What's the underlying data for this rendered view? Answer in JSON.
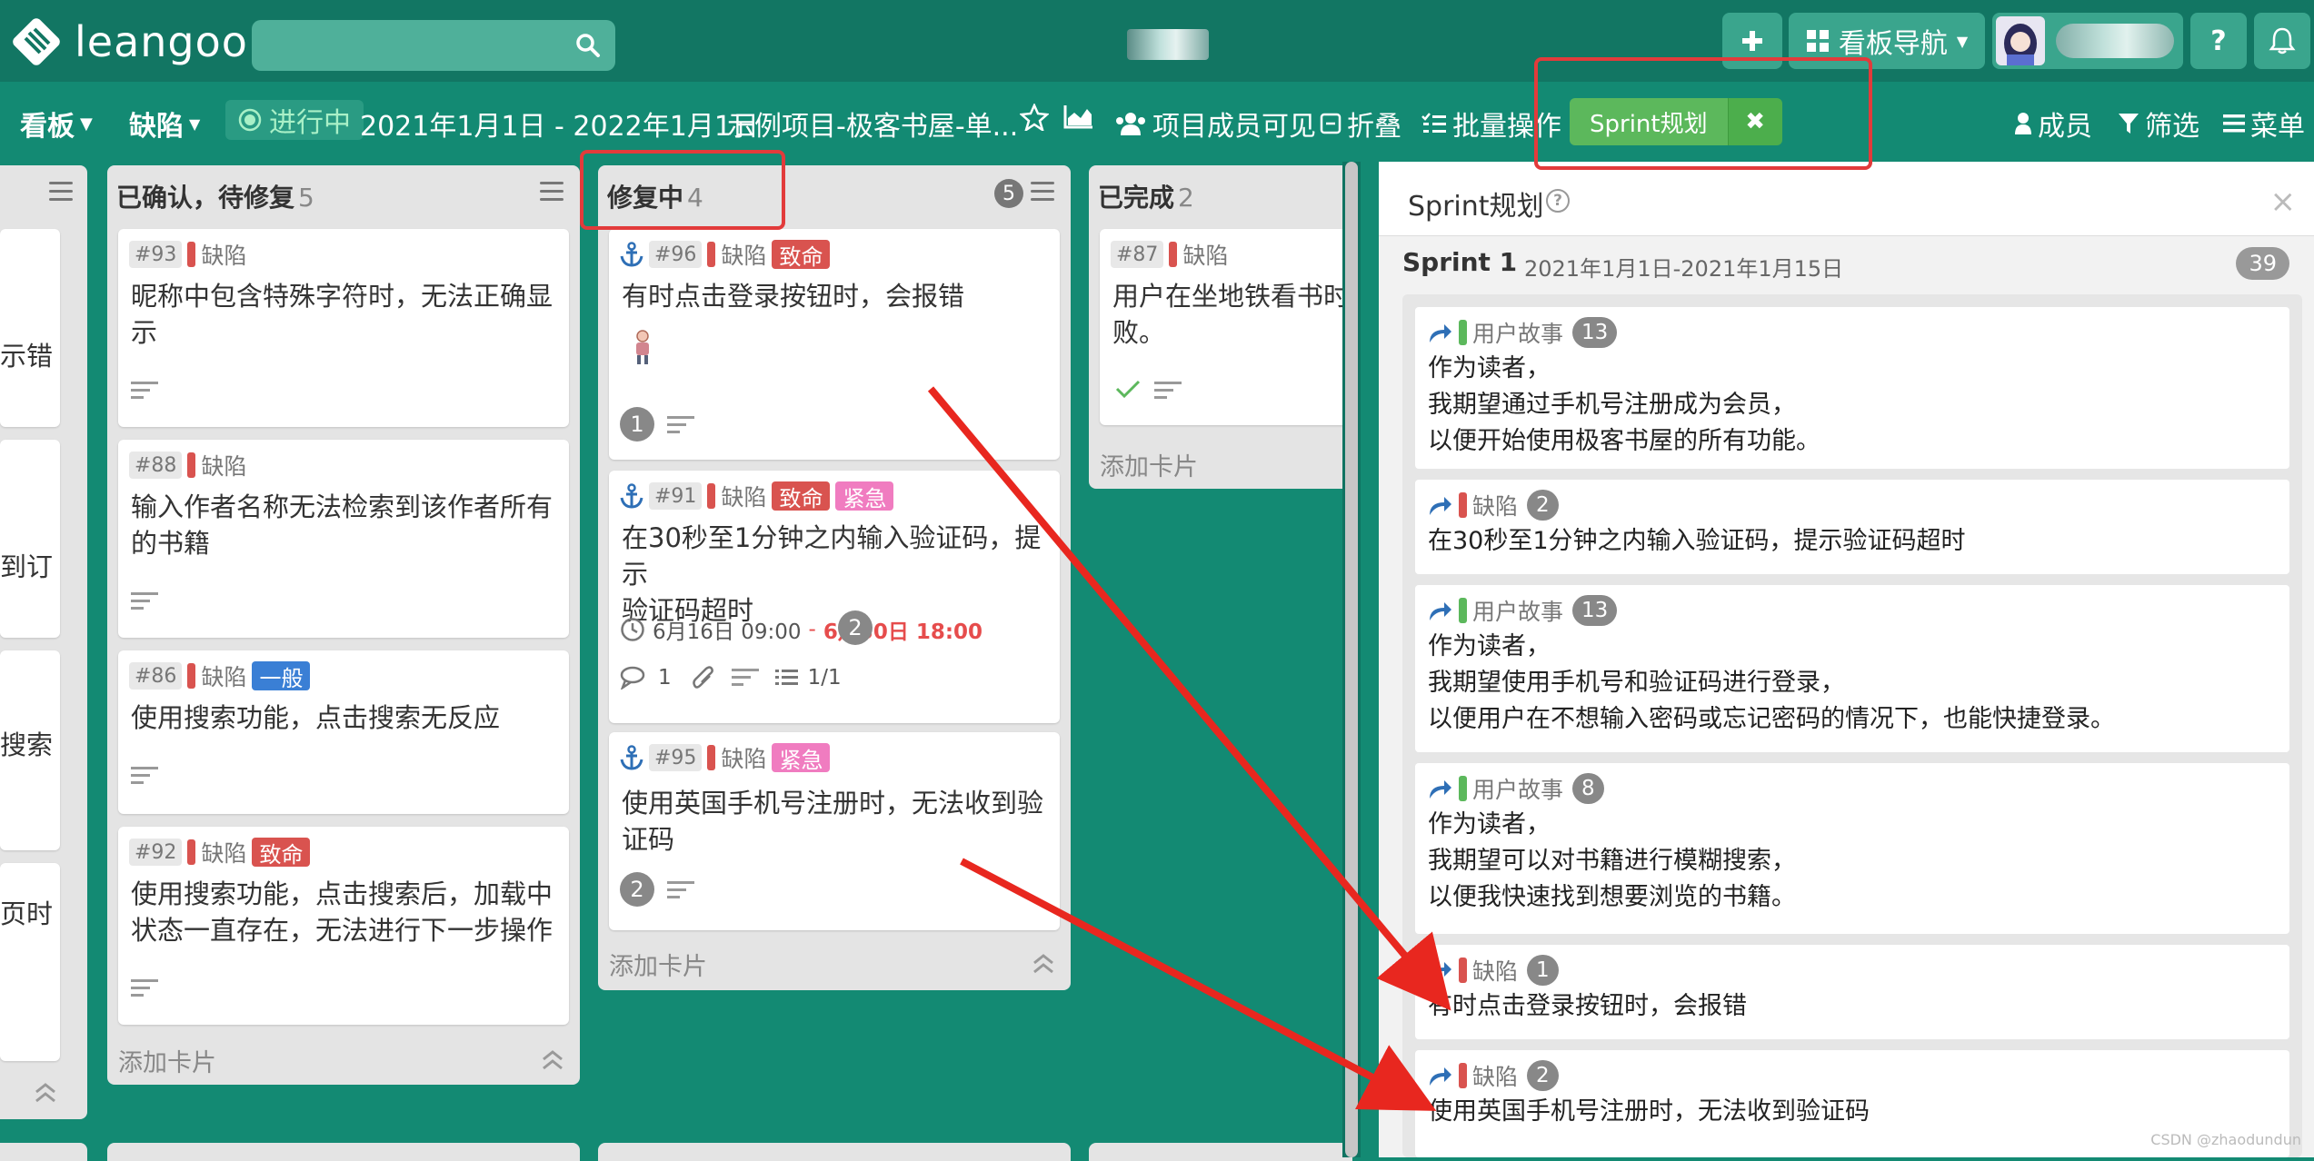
{
  "app": {
    "logo_text": "leangoo"
  },
  "topbar": {
    "search_placeholder": "",
    "board_nav_label": "看板导航",
    "help_label": "?"
  },
  "boardbar": {
    "kanban_label": "看板",
    "board_name": "缺陷",
    "status": "进行中",
    "date_range": "2021年1月1日 - 2022年1月1日",
    "project": "示例项目-极客书屋-单...",
    "visibility": "项目成员可见",
    "fold": "折叠",
    "batch": "批量操作",
    "sprint_button": "Sprint规划",
    "sprint_close": "✖",
    "members": "成员",
    "filter": "筛选",
    "menu": "菜单"
  },
  "lists": {
    "left_partial": {
      "cards": [
        "示错",
        "到订",
        "搜索",
        "页时"
      ]
    },
    "confirmed": {
      "title": "已确认，待修复",
      "count": "5",
      "add_card": "添加卡片",
      "cards": [
        {
          "id": "#93",
          "type": "缺陷",
          "tags": [],
          "title_lines": [
            "昵称中包含特殊字符时，无法正确显",
            "示"
          ]
        },
        {
          "id": "#88",
          "type": "缺陷",
          "tags": [],
          "title_lines": [
            "输入作者名称无法检索到该作者所有",
            "的书籍"
          ]
        },
        {
          "id": "#86",
          "type": "缺陷",
          "tags": [
            {
              "label": "一般",
              "color": "#3a7fd5"
            }
          ],
          "title_lines": [
            "使用搜索功能，点击搜索无反应"
          ]
        },
        {
          "id": "#92",
          "type": "缺陷",
          "tags": [
            {
              "label": "致命",
              "color": "#d9534f"
            }
          ],
          "title_lines": [
            "使用搜索功能，点击搜索后，加载中",
            "状态一直存在，无法进行下一步操作"
          ]
        }
      ]
    },
    "fixing": {
      "title": "修复中",
      "count": "4",
      "wip_limit": "5",
      "add_card": "添加卡片",
      "cards": [
        {
          "id": "#96",
          "type": "缺陷",
          "tags": [
            {
              "label": "致命",
              "color": "#d9534f"
            }
          ],
          "title_lines": [
            "有时点击登录按钮时，会报错"
          ],
          "badge": "1"
        },
        {
          "id": "#91",
          "type": "缺陷",
          "tags": [
            {
              "label": "致命",
              "color": "#d9534f"
            },
            {
              "label": "紧急",
              "color": "#f07cc0"
            }
          ],
          "title_lines": [
            "在30秒至1分钟之内输入验证码，提示",
            "验证码超时"
          ],
          "badge": "2",
          "start": "6月16日 09:00",
          "dash": "-",
          "due": "6月30日 18:00",
          "comments": "1",
          "checklist": "1/1"
        },
        {
          "id": "#95",
          "type": "缺陷",
          "tags": [
            {
              "label": "紧急",
              "color": "#f07cc0"
            }
          ],
          "title_lines": [
            "使用英国手机号注册时，无法收到验",
            "证码"
          ],
          "badge": "2"
        }
      ]
    },
    "done": {
      "title": "已完成",
      "count": "2",
      "add_card": "添加卡片",
      "cards": [
        {
          "id": "#87",
          "type": "缺陷",
          "title_lines": [
            "用户在坐地铁看书时",
            "败。"
          ]
        }
      ]
    }
  },
  "sprint_panel": {
    "title": "Sprint规划",
    "help": "?",
    "close": "×",
    "sprint_name": "Sprint 1",
    "sprint_dates": "2021年1月1日-2021年1月15日",
    "sprint_count": "39",
    "cards": [
      {
        "type": "用户故事",
        "type_color": "#5cb85c",
        "badge": "13",
        "lines": [
          "作为读者，",
          "我期望通过手机号注册成为会员，",
          "以便开始使用极客书屋的所有功能。"
        ]
      },
      {
        "type": "缺陷",
        "type_color": "#d9534f",
        "badge": "2",
        "lines": [
          "在30秒至1分钟之内输入验证码，提示验证码超时"
        ]
      },
      {
        "type": "用户故事",
        "type_color": "#5cb85c",
        "badge": "13",
        "lines": [
          "作为读者，",
          "我期望使用手机号和验证码进行登录，",
          "以便用户在不想输入密码或忘记密码的情况下，也能快捷登录。"
        ]
      },
      {
        "type": "用户故事",
        "type_color": "#5cb85c",
        "badge": "8",
        "lines": [
          "作为读者，",
          "我期望可以对书籍进行模糊搜索，",
          "以便我快速找到想要浏览的书籍。"
        ]
      },
      {
        "type": "缺陷",
        "type_color": "#d9534f",
        "badge": "1",
        "lines": [
          "有时点击登录按钮时，会报错"
        ]
      },
      {
        "type": "缺陷",
        "type_color": "#d9534f",
        "badge": "2",
        "lines": [
          "使用英国手机号注册时，无法收到验证码"
        ]
      }
    ]
  },
  "watermark": "CSDN @zhaodundun",
  "colors": {
    "bug": "#d9534f",
    "story": "#5cb85c",
    "accent": "#138a73",
    "annotation": "#e23b3b"
  }
}
